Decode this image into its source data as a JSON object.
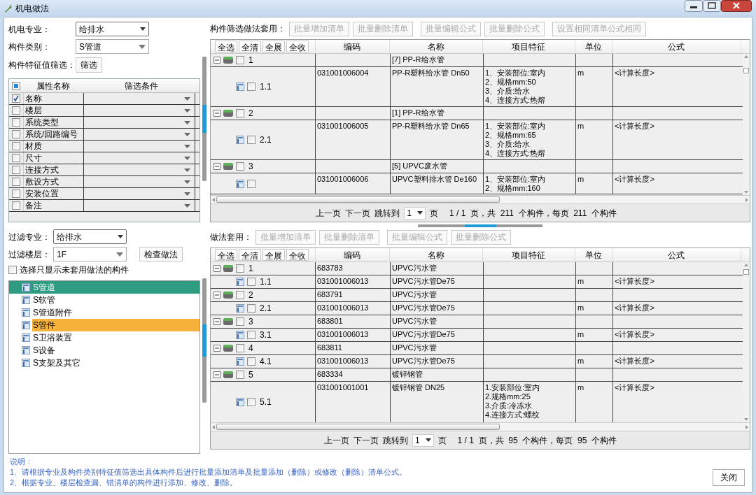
{
  "window": {
    "title": "机电做法"
  },
  "left": {
    "fields": [
      {
        "label": "机电专业：",
        "value": "给排水",
        "kind": "select"
      },
      {
        "label": "构件类别：",
        "value": "S管道",
        "kind": "combo"
      }
    ],
    "feature_filter": {
      "label": "构件特征值筛选：",
      "button": "筛选"
    },
    "attr_table": {
      "partially_checked": true,
      "columns": [
        "属性名称",
        "筛选条件"
      ],
      "rows": [
        {
          "name": "名称",
          "checked": true
        },
        {
          "name": "楼层",
          "checked": false
        },
        {
          "name": "系统类型",
          "checked": false
        },
        {
          "name": "系统/回路编号",
          "checked": false
        },
        {
          "name": "材质",
          "checked": false
        },
        {
          "name": "尺寸",
          "checked": false
        },
        {
          "name": "连接方式",
          "checked": false
        },
        {
          "name": "敷设方式",
          "checked": false
        },
        {
          "name": "安装位置",
          "checked": false
        },
        {
          "name": "备注",
          "checked": false
        }
      ]
    },
    "filter_fields": [
      {
        "label": "过滤专业：",
        "value": "给排水",
        "kind": "select"
      },
      {
        "label": "过滤楼层：",
        "value": "1F",
        "kind": "combo"
      }
    ],
    "check_button": "检查做法",
    "unused_only": {
      "label": "选择只显示未套用做法的构件",
      "checked": false
    },
    "tree": [
      {
        "label": "S管道",
        "selected": true,
        "highlighted": false
      },
      {
        "label": "S软管",
        "selected": false,
        "highlighted": false
      },
      {
        "label": "S管道附件",
        "selected": false,
        "highlighted": false
      },
      {
        "label": "S管件",
        "selected": false,
        "highlighted": true
      },
      {
        "label": "S卫浴装置",
        "selected": false,
        "highlighted": false
      },
      {
        "label": "S设备",
        "selected": false,
        "highlighted": false
      },
      {
        "label": "S支架及其它",
        "selected": false,
        "highlighted": false
      }
    ]
  },
  "grids": [
    {
      "toolbar_label": "构件筛选做法套用：",
      "actions": [
        {
          "label": "批量增加清单",
          "disabled": true
        },
        {
          "label": "批量删除清单",
          "disabled": true
        },
        {
          "label": "批量编辑公式",
          "disabled": true
        },
        {
          "label": "批量删除公式",
          "disabled": true
        },
        {
          "label": "设置相同清单公式相同",
          "disabled": true
        }
      ],
      "tree_buttons": [
        "全选",
        "全清",
        "全展",
        "全收"
      ],
      "columns": [
        "编码",
        "名称",
        "项目特征",
        "单位",
        "公式"
      ],
      "rows": [
        {
          "kind": "group",
          "label": "1",
          "expanded": true,
          "checked": false,
          "name": "[7] PP-R给水管"
        },
        {
          "kind": "item",
          "label": "1.1",
          "checked": false,
          "code": "031001006004",
          "name": "PP-R塑料给水管 Dn50",
          "features": [
            "1、安装部位:室内",
            "2、规格mm:50",
            "3、介质:给水",
            "4、连接方式:热熔"
          ],
          "unit": "m",
          "formula": "<计算长度>"
        },
        {
          "kind": "group",
          "label": "2",
          "expanded": true,
          "checked": false,
          "name": "[1] PP-R给水管"
        },
        {
          "kind": "item",
          "label": "2.1",
          "checked": false,
          "code": "031001006005",
          "name": "PP-R塑料给水管 Dn65",
          "features": [
            "1、安装部位:室内",
            "2、规格mm:65",
            "3、介质:给水",
            "4、连接方式:热熔"
          ],
          "unit": "m",
          "formula": "<计算长度>"
        },
        {
          "kind": "group",
          "label": "3",
          "expanded": true,
          "checked": false,
          "name": "[5] UPVC废水管"
        },
        {
          "kind": "item",
          "checked": false,
          "code": "031001006006",
          "name": "UPVC塑料排水管 De160",
          "features": [
            "1、安装部位:室内",
            "2、规格mm:160"
          ],
          "unit": "m",
          "formula": "<计算长度>"
        }
      ],
      "pager": {
        "prev": "上一页",
        "next": "下一页",
        "jump": "跳转到",
        "page": "1",
        "page_unit": "页",
        "summary": "1 / 1  页，共  211  个构件，每页  211  个构件"
      }
    },
    {
      "toolbar_label": "做法套用：",
      "actions": [
        {
          "label": "批量增加清单",
          "disabled": true
        },
        {
          "label": "批量删除清单",
          "disabled": true
        },
        {
          "label": "批量编辑公式",
          "disabled": true
        },
        {
          "label": "批量删除公式",
          "disabled": true
        }
      ],
      "tree_buttons": [
        "全选",
        "全清",
        "全展",
        "全收"
      ],
      "columns": [
        "编码",
        "名称",
        "项目特征",
        "单位",
        "公式"
      ],
      "rows": [
        {
          "kind": "group",
          "label": "1",
          "expanded": true,
          "checked": false,
          "code": "683783",
          "name": "UPVC污水管"
        },
        {
          "kind": "item",
          "label": "1.1",
          "checked": false,
          "code": "031001006013",
          "name": "UPVC污水管De75",
          "unit": "m",
          "formula": "<计算长度>"
        },
        {
          "kind": "group",
          "label": "2",
          "expanded": true,
          "checked": false,
          "code": "683791",
          "name": "UPVC污水管"
        },
        {
          "kind": "item",
          "label": "2.1",
          "checked": false,
          "code": "031001006013",
          "name": "UPVC污水管De75",
          "unit": "m",
          "formula": "<计算长度>"
        },
        {
          "kind": "group",
          "label": "3",
          "expanded": true,
          "checked": false,
          "code": "683801",
          "name": "UPVC污水管"
        },
        {
          "kind": "item",
          "label": "3.1",
          "checked": false,
          "code": "031001006013",
          "name": "UPVC污水管De75",
          "unit": "m",
          "formula": "<计算长度>"
        },
        {
          "kind": "group",
          "label": "4",
          "expanded": true,
          "checked": false,
          "code": "683811",
          "name": "UPVC污水管"
        },
        {
          "kind": "item",
          "label": "4.1",
          "checked": false,
          "code": "031001006013",
          "name": "UPVC污水管De75",
          "unit": "m",
          "formula": "<计算长度>"
        },
        {
          "kind": "group",
          "label": "5",
          "expanded": true,
          "checked": false,
          "code": "683334",
          "name": "镀锌钢管"
        },
        {
          "kind": "item",
          "label": "5.1",
          "checked": false,
          "code": "031001001001",
          "name": "镀锌钢管 DN25",
          "features": [
            "1.安装部位:室内",
            "2.规格mm:25",
            "3.介质:冷冻水",
            "4.连接方式:螺纹"
          ],
          "unit": "m",
          "formula": "<计算长度>"
        }
      ],
      "pager": {
        "prev": "上一页",
        "next": "下一页",
        "jump": "跳转到",
        "page": "1",
        "page_unit": "页",
        "summary": "1 / 1  页，共  95  个构件，每页  95  个构件"
      }
    }
  ],
  "notes": {
    "title": "说明：",
    "lines": [
      "1、请根据专业及构件类别特征值筛选出具体构件后进行批量添加清单及批量添加（删除）或修改（删除）清单公式。",
      "2、根据专业、楼层检查漏、错清单的构件进行添加、修改、删除。"
    ]
  },
  "close_button": "关闭"
}
